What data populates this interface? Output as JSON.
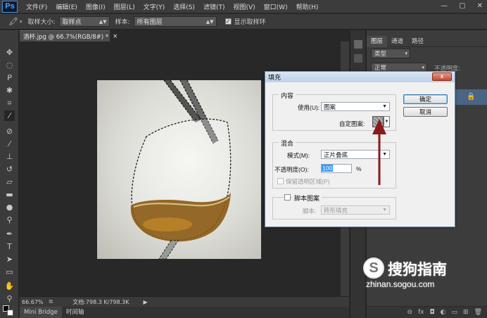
{
  "app": {
    "logo": "Ps"
  },
  "menu": [
    "文件(F)",
    "编辑(E)",
    "图像(I)",
    "图层(L)",
    "文字(Y)",
    "选择(S)",
    "滤镜(T)",
    "视图(V)",
    "窗口(W)",
    "帮助(H)"
  ],
  "window_controls": {
    "minimize": "—",
    "restore": "▢",
    "close": "✕"
  },
  "options_bar": {
    "sample_size_label": "取样大小:",
    "sample_size_value": "取样点",
    "sample_label": "样本:",
    "sample_value": "所有图层",
    "show_ring_label": "显示取样环",
    "show_ring_checked": true
  },
  "document": {
    "tab_title": "酒杯.jpg @ 66.7%(RGB/8#) *",
    "tab_close": "×"
  },
  "status_bar": {
    "zoom": "66.67%",
    "doc_info": "文档:798.3 K/798.3K"
  },
  "bottom_tabs": [
    "Mini Bridge",
    "时间轴"
  ],
  "panel": {
    "tabs": [
      "图层",
      "通道",
      "路径"
    ],
    "filter_kind": "类型",
    "blend_mode": "正常",
    "opacity_label": "不透明度:"
  },
  "dialog": {
    "title": "填充",
    "close_label": "x",
    "contents_group": "内容",
    "use_label": "使用(U):",
    "use_value": "图案",
    "custom_pattern_label": "自定图案:",
    "blending_group": "混合",
    "mode_label": "模式(M):",
    "mode_value": "正片叠底",
    "opacity_label": "不透明度(O):",
    "opacity_value": "100",
    "opacity_unit": "%",
    "preserve_label": "保留透明区域(P)",
    "script_label": "脚本图案",
    "script_field_label": "脚本:",
    "script_value": "砖形填充",
    "ok": "确定",
    "cancel": "取消"
  },
  "watermark": {
    "logo": "S",
    "name": "搜狗指南",
    "url": "zhinan.sogou.com"
  },
  "colors": {
    "accent_red": "#8b1a1a",
    "highlight_blue": "#3399ff"
  }
}
